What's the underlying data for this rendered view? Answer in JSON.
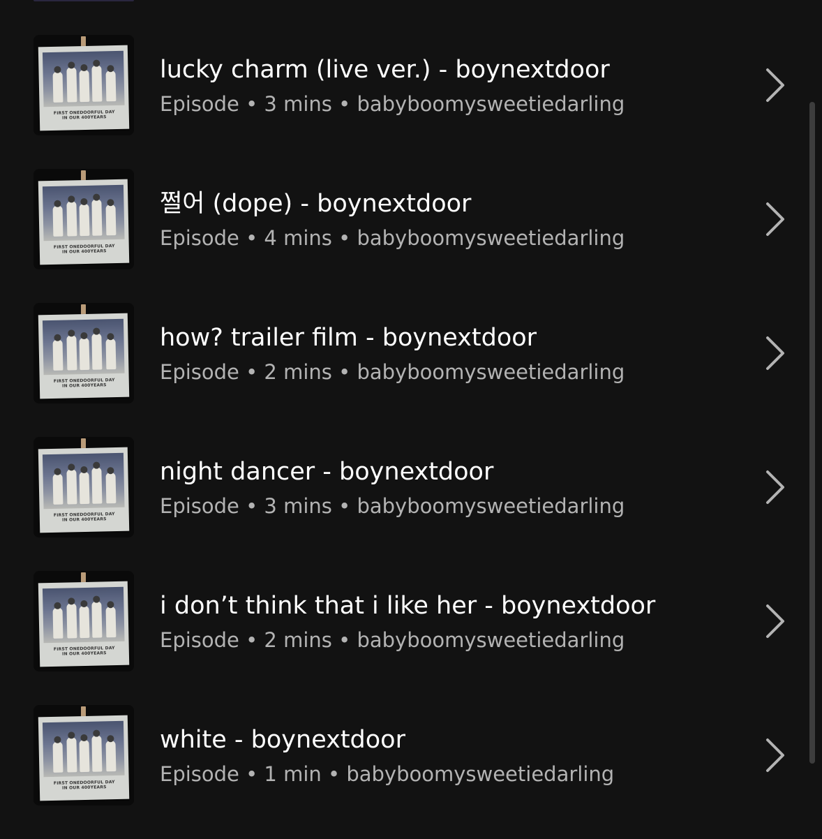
{
  "colors": {
    "background": "#121212",
    "title": "#ffffff",
    "meta": "#b3b3b3",
    "chevron": "#b3b3b3",
    "scrollbar": "#3d3d3d"
  },
  "artwork": {
    "caption_line1": "FIRST ONEDOORFUL DAY",
    "caption_line2": "IN OUR 400YEARS"
  },
  "episodes": [
    {
      "title": "lucky charm (live ver.) - boynextdoor",
      "meta": "Episode • 3 mins • babyboomysweetiedarling"
    },
    {
      "title": "쩔어 (dope) - boynextdoor",
      "meta": "Episode • 4 mins • babyboomysweetiedarling"
    },
    {
      "title": "how? trailer film - boynextdoor",
      "meta": "Episode • 2 mins • babyboomysweetiedarling"
    },
    {
      "title": "night dancer - boynextdoor",
      "meta": "Episode • 3 mins • babyboomysweetiedarling"
    },
    {
      "title": "i don’t think that i like her - boynextdoor",
      "meta": "Episode • 2 mins • babyboomysweetiedarling"
    },
    {
      "title": "white - boynextdoor",
      "meta": "Episode • 1 min • babyboomysweetiedarling"
    }
  ],
  "icons": {
    "row_action": "chevron-right-icon",
    "artwork": "episode-cover-image"
  }
}
